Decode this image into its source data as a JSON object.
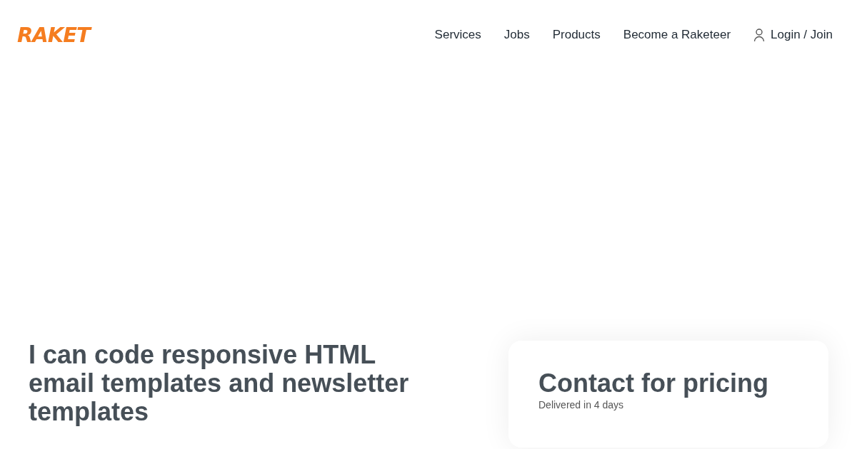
{
  "logo": {
    "text": "RAKET"
  },
  "nav": [
    {
      "label": "Services",
      "kind": "link"
    },
    {
      "label": "Jobs",
      "kind": "link"
    },
    {
      "label": "Products",
      "kind": "link"
    },
    {
      "label": "Become a Raketeer",
      "kind": "link"
    },
    {
      "label": "Login / Join",
      "kind": "login"
    }
  ],
  "service": {
    "title": "I can code responsive HTML email templates and newsletter templates"
  },
  "pricing": {
    "heading": "Contact for pricing",
    "delivery": "Delivered in 4 days"
  }
}
